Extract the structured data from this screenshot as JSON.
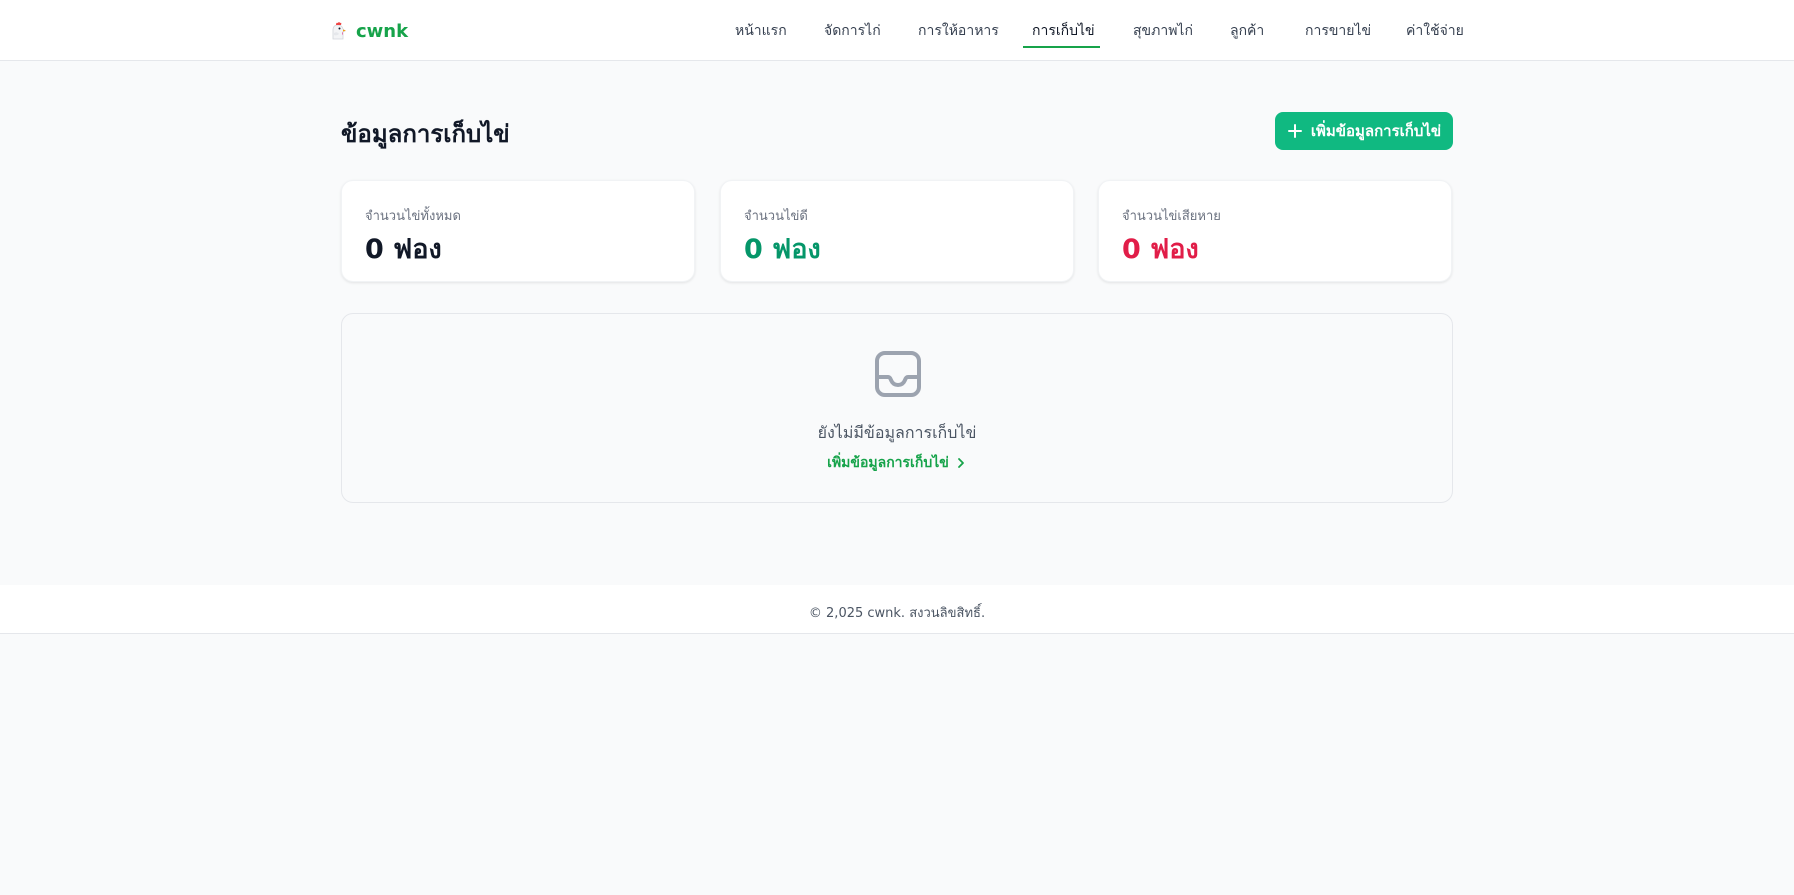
{
  "brand": {
    "name": "cwnk",
    "logo_icon": "chicken-icon",
    "color": "#16a34a"
  },
  "nav": {
    "items": [
      {
        "label": "หน้าแรก",
        "active": false
      },
      {
        "label": "จัดการไก่",
        "active": false
      },
      {
        "label": "การให้อาหาร",
        "active": false
      },
      {
        "label": "การเก็บไข่",
        "active": true
      },
      {
        "label": "สุขภาพไก่",
        "active": false
      },
      {
        "label": "ลูกค้า",
        "active": false
      },
      {
        "label": "การขายไข่",
        "active": false
      },
      {
        "label": "ค่าใช้จ่าย",
        "active": false
      }
    ]
  },
  "page": {
    "title": "ข้อมูลการเก็บไข่",
    "add_button_label": "เพิ่มข้อมูลการเก็บไข่",
    "add_button_icon": "plus-icon",
    "accent": "#10b981"
  },
  "stats": [
    {
      "label": "จำนวนไข่ทั้งหมด",
      "value": "0 ฟอง",
      "color": "#111827"
    },
    {
      "label": "จำนวนไข่ดี",
      "value": "0 ฟอง",
      "color": "#059669"
    },
    {
      "label": "จำนวนไข่เสียหาย",
      "value": "0 ฟอง",
      "color": "#e11d48"
    }
  ],
  "empty_state": {
    "icon": "inbox-icon",
    "message": "ยังไม่มีข้อมูลการเก็บไข่",
    "link_label": "เพิ่มข้อมูลการเก็บไข่",
    "link_icon": "chevron-right-icon"
  },
  "footer": {
    "text": "© 2,025 cwnk. สงวนลิขสิทธิ์."
  }
}
